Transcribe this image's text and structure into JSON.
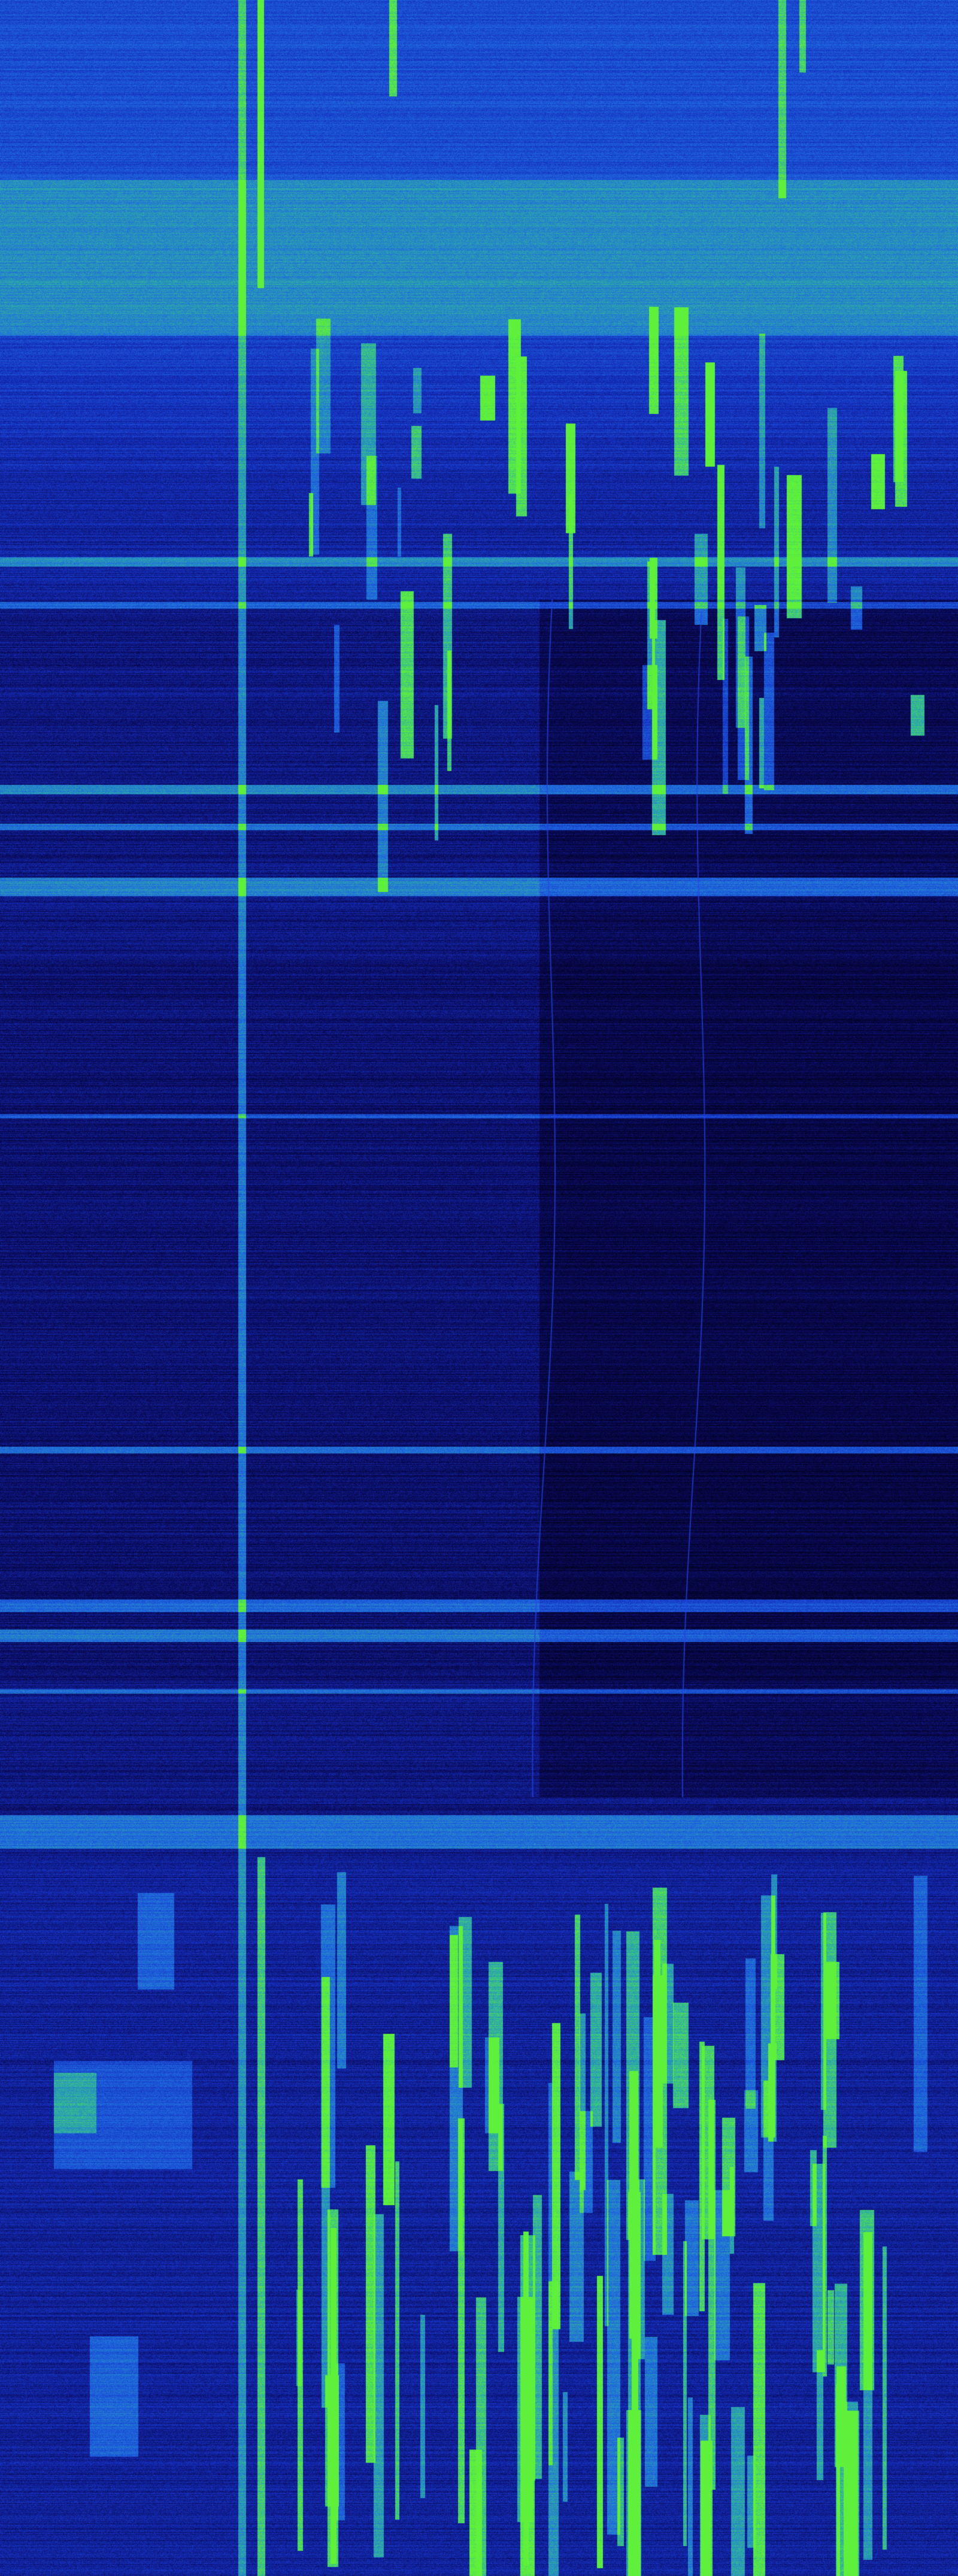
{
  "waterfall": {
    "colormap": [
      "#000010",
      "#0a0a5a",
      "#1530c0",
      "#1f6ae0",
      "#2fb0a0",
      "#5ef03a"
    ],
    "background": "#00002a"
  }
}
